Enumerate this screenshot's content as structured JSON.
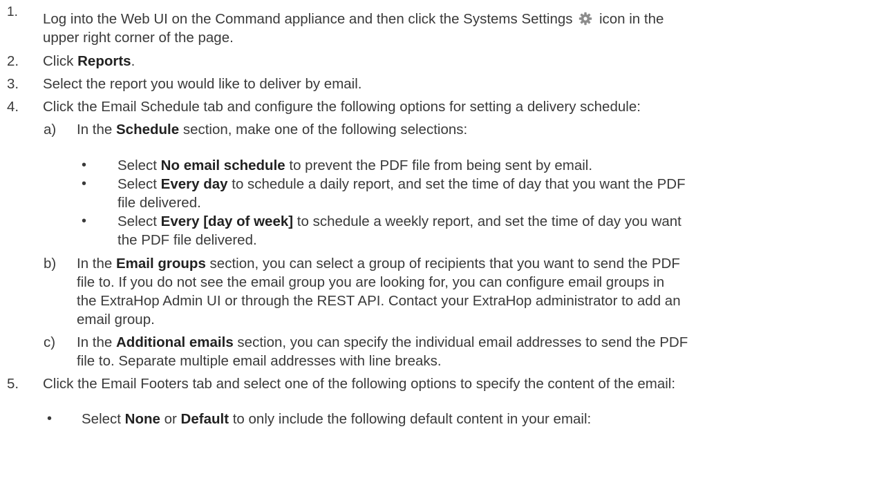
{
  "steps": [
    {
      "num": "1.",
      "line1_a": "Log into the Web UI on the Command appliance and then click the Systems Settings",
      "line1_b": "icon in the",
      "line2": "upper right corner of the page.",
      "icon": "gear-icon"
    },
    {
      "num": "2.",
      "a": "Click ",
      "b": "Reports",
      "c": "."
    },
    {
      "num": "3.",
      "text": "Select the report you would like to deliver by email."
    },
    {
      "num": "4.",
      "text": "Click the Email Schedule tab and configure the following options for setting a delivery schedule:"
    },
    {
      "num": "5.",
      "text": "Click the Email Footers tab and select one of the following options to specify the content of the email:"
    }
  ],
  "substeps": {
    "a": {
      "label": "a)",
      "pre": "In the ",
      "bold": "Schedule",
      "post": " section, make one of the following selections:",
      "bullets": [
        {
          "pre": "Select ",
          "bold": "No email schedule",
          "post": " to prevent the PDF file from being sent by email."
        },
        {
          "pre": "Select ",
          "bold": "Every day",
          "post": " to schedule a daily report, and set the time of day that you want the PDF",
          "line2": "file delivered."
        },
        {
          "pre": "Select ",
          "bold": "Every [day of week]",
          "post": " to schedule a weekly report, and set the time of day you want",
          "line2": "the PDF file delivered."
        }
      ]
    },
    "b": {
      "label": "b)",
      "pre": "In the ",
      "bold": "Email groups",
      "post": " section, you can select a group of recipients that you want to send the PDF",
      "line2": "file to. If you do not see the email group you are looking for, you can configure email groups in",
      "line3": "the ExtraHop Admin UI or through the REST API. Contact your ExtraHop administrator to add an",
      "line4": "email group."
    },
    "c": {
      "label": "c)",
      "pre": "In the ",
      "bold": "Additional emails",
      "post": " section, you can specify the individual email addresses to send the PDF",
      "line2": "file to. Separate multiple email addresses with line breaks."
    }
  },
  "step5_bullet": {
    "pre": "Select ",
    "bold1": "None",
    "mid": " or ",
    "bold2": "Default",
    "post": " to only include the following default content in your email:"
  },
  "bullet_char": "•"
}
